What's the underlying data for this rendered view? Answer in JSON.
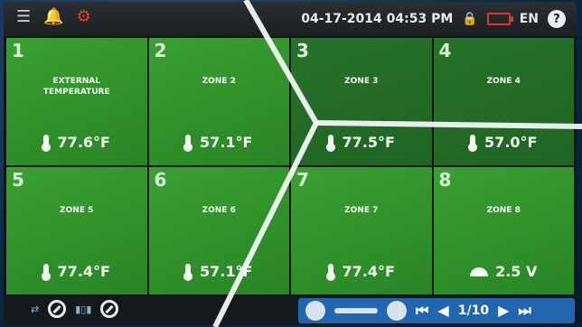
{
  "header": {
    "datetime": "04-17-2014 04:53 PM",
    "language": "EN",
    "help_label": "?"
  },
  "tiles": [
    {
      "num": "1",
      "name": "EXTERNAL TEMPERATURE",
      "value": "77.6°F",
      "icon": "thermometer-icon"
    },
    {
      "num": "2",
      "name": "ZONE 2",
      "value": "57.1°F",
      "icon": "thermometer-icon"
    },
    {
      "num": "3",
      "name": "ZONE 3",
      "value": "77.5°F",
      "icon": "thermometer-icon"
    },
    {
      "num": "4",
      "name": "ZONE 4",
      "value": "57.0°F",
      "icon": "thermometer-icon"
    },
    {
      "num": "5",
      "name": "ZONE 5",
      "value": "77.4°F",
      "icon": "thermometer-icon"
    },
    {
      "num": "6",
      "name": "ZONE 6",
      "value": "57.1°F",
      "icon": "thermometer-icon"
    },
    {
      "num": "7",
      "name": "ZONE 7",
      "value": "77.4°F",
      "icon": "thermometer-icon"
    },
    {
      "num": "8",
      "name": "ZONE 8",
      "value": "2.5 V",
      "icon": "gauge-icon"
    }
  ],
  "pager": {
    "label": "1/10"
  },
  "colors": {
    "tile_green": "#2f8f2a",
    "tile_dim": "#1f6423",
    "pager_blue": "#2266b0",
    "alarm": "#e2452b"
  }
}
